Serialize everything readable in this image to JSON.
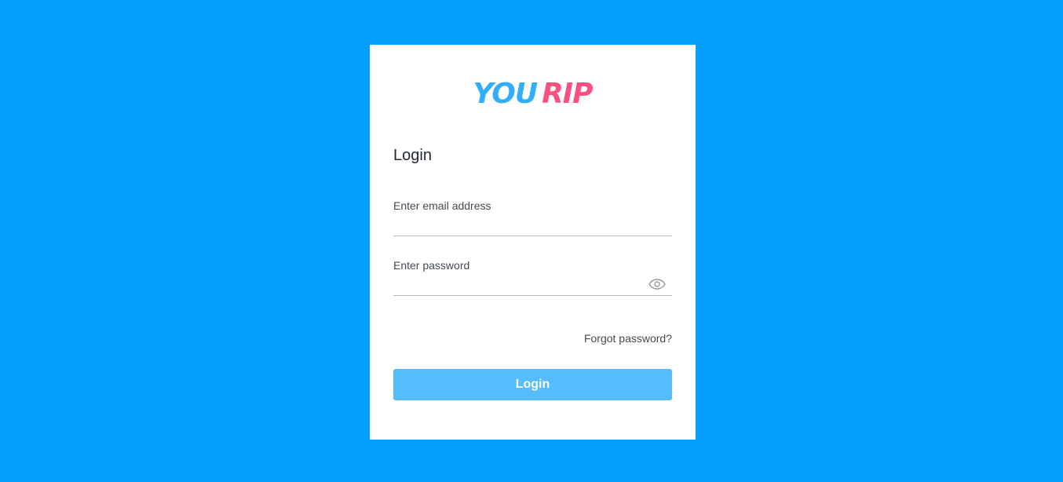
{
  "logo": {
    "part1": "YOU",
    "part2": "RIP",
    "color1": "#32aef9",
    "color2": "#fb4f80"
  },
  "background_color": "#069ffe",
  "form": {
    "title": "Login",
    "email": {
      "label": "Enter email address",
      "value": "",
      "placeholder": ""
    },
    "password": {
      "label": "Enter password",
      "value": "",
      "placeholder": "",
      "toggle_icon": "eye-icon"
    },
    "forgot_link": "Forgot password?",
    "submit_label": "Login",
    "submit_color": "#55bcfd"
  }
}
